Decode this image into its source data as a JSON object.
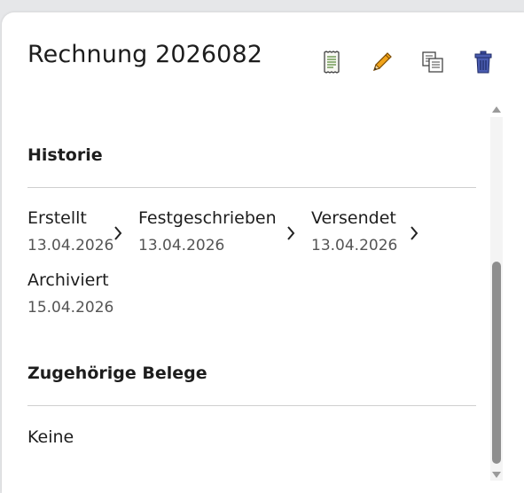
{
  "header": {
    "title": "Rechnung 2026082"
  },
  "toolbar": {
    "icons": [
      "receipt-icon",
      "pencil-icon",
      "copy-icon",
      "trash-icon"
    ],
    "accent_pencil": "#f0a31a",
    "accent_trash": "#3a4a9c"
  },
  "history": {
    "heading": "Historie",
    "steps": [
      {
        "name": "Erstellt",
        "date": "13.04.2026"
      },
      {
        "name": "Festgeschrieben",
        "date": "13.04.2026"
      },
      {
        "name": "Versendet",
        "date": "13.04.2026"
      },
      {
        "name": "Archiviert",
        "date": "15.04.2026"
      }
    ]
  },
  "related": {
    "heading": "Zugehörige Belege",
    "empty_text": "Keine"
  }
}
